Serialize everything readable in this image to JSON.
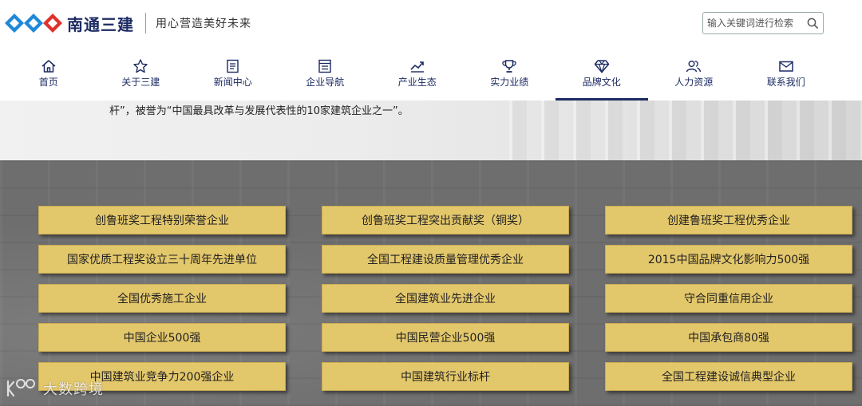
{
  "header": {
    "brand_name": "南通三建",
    "slogan": "用心营造美好未来",
    "search_placeholder": "输入关键词进行检索"
  },
  "nav": {
    "items": [
      {
        "label": "首页",
        "icon": "home-icon"
      },
      {
        "label": "关于三建",
        "icon": "star-icon"
      },
      {
        "label": "新闻中心",
        "icon": "news-icon"
      },
      {
        "label": "企业导航",
        "icon": "document-icon"
      },
      {
        "label": "产业生态",
        "icon": "trend-chart-icon"
      },
      {
        "label": "实力业绩",
        "icon": "trophy-icon"
      },
      {
        "label": "品牌文化",
        "icon": "diamond-icon"
      },
      {
        "label": "人力资源",
        "icon": "people-icon"
      },
      {
        "label": "联系我们",
        "icon": "mail-icon"
      }
    ],
    "active_label": "品牌文化"
  },
  "intro": {
    "text": "杆”，被誉为“中国最具改革与发展代表性的10家建筑企业之一”。"
  },
  "awards": [
    "创鲁班奖工程特别荣誉企业",
    "创鲁班奖工程突出贡献奖（铜奖）",
    "创建鲁班奖工程优秀企业",
    "国家优质工程奖设立三十周年先进单位",
    "全国工程建设质量管理优秀企业",
    "2015中国品牌文化影响力500强",
    "全国优秀施工企业",
    "全国建筑业先进企业",
    "守合同重信用企业",
    "中国企业500强",
    "中国民营企业500强",
    "中国承包商80强",
    "中国建筑业竞争力200强企业",
    "中国建筑行业标杆",
    "全国工程建设诚信典型企业"
  ],
  "watermark": {
    "text": "大数跨境"
  },
  "colors": {
    "brand_navy": "#1d2b63",
    "logo_blue": "#1e88d8",
    "logo_red": "#e0312b",
    "award_gold": "#e3c76b",
    "section_gray": "#6e6e6e"
  }
}
